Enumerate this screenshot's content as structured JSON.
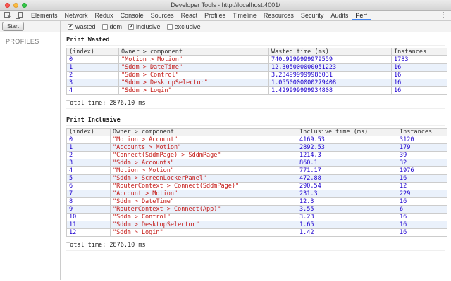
{
  "window": {
    "title": "Developer Tools - http://localhost:4001/"
  },
  "tabs": {
    "items": [
      {
        "label": "Elements",
        "active": false
      },
      {
        "label": "Network",
        "active": false
      },
      {
        "label": "Redux",
        "active": false
      },
      {
        "label": "Console",
        "active": false
      },
      {
        "label": "Sources",
        "active": false
      },
      {
        "label": "React",
        "active": false
      },
      {
        "label": "Profiles",
        "active": false
      },
      {
        "label": "Timeline",
        "active": false
      },
      {
        "label": "Resources",
        "active": false
      },
      {
        "label": "Security",
        "active": false
      },
      {
        "label": "Audits",
        "active": false
      },
      {
        "label": "Perf",
        "active": true
      }
    ],
    "icons": [
      "inspect-element-icon",
      "device-toolbar-icon",
      "more-options-icon"
    ]
  },
  "toolbar": {
    "start_label": "Start",
    "checkboxes": [
      {
        "label": "wasted",
        "checked": true
      },
      {
        "label": "dom",
        "checked": false
      },
      {
        "label": "inclusive",
        "checked": true
      },
      {
        "label": "exclusive",
        "checked": false
      }
    ]
  },
  "sidebar": {
    "heading": "PROFILES"
  },
  "main": {
    "sections": [
      {
        "title": "Print Wasted",
        "table": {
          "columns": [
            "(index)",
            "Owner > component",
            "Wasted time (ms)",
            "Instances"
          ],
          "rows": [
            [
              "0",
              "\"Motion > Motion\"",
              "740.9299999979559",
              "1783"
            ],
            [
              "1",
              "\"Sddm > DateTime\"",
              "12.305000000051223",
              "16"
            ],
            [
              "2",
              "\"Sddm > Control\"",
              "3.234999999986031",
              "16"
            ],
            [
              "3",
              "\"Sddm > DesktopSelector\"",
              "1.0550000000279408",
              "16"
            ],
            [
              "4",
              "\"Sddm > Login\"",
              "1.429999999934808",
              "16"
            ]
          ]
        },
        "total": "Total time: 2876.10 ms"
      },
      {
        "title": "Print Inclusive",
        "table": {
          "columns": [
            "(index)",
            "Owner > component",
            "Inclusive time (ms)",
            "Instances"
          ],
          "rows": [
            [
              "0",
              "\"Motion > Account\"",
              "4169.53",
              "3120"
            ],
            [
              "1",
              "\"Accounts > Motion\"",
              "2892.53",
              "179"
            ],
            [
              "2",
              "\"Connect(SddmPage) > SddmPage\"",
              "1214.3",
              "39"
            ],
            [
              "3",
              "\"Sddm > Accounts\"",
              "860.1",
              "32"
            ],
            [
              "4",
              "\"Motion > Motion\"",
              "771.17",
              "1976"
            ],
            [
              "5",
              "\"Sddm > ScreenLockerPanel\"",
              "472.88",
              "16"
            ],
            [
              "6",
              "\"RouterContext > Connect(SddmPage)\"",
              "290.54",
              "12"
            ],
            [
              "7",
              "\"Account > Motion\"",
              "231.3",
              "229"
            ],
            [
              "8",
              "\"Sddm > DateTime\"",
              "12.3",
              "16"
            ],
            [
              "9",
              "\"RouterContext > Connect(App)\"",
              "3.55",
              "6"
            ],
            [
              "10",
              "\"Sddm > Control\"",
              "3.23",
              "16"
            ],
            [
              "11",
              "\"Sddm > DesktopSelector\"",
              "1.65",
              "16"
            ],
            [
              "12",
              "\"Sddm > Login\"",
              "1.42",
              "16"
            ]
          ]
        },
        "total": "Total time: 2876.10 ms"
      }
    ]
  },
  "colors": {
    "accent": "#4285f4",
    "string_value": "#c41a16",
    "number_value": "#1c00cf",
    "row_stripe": "#eaf1fb",
    "chrome_bg": "#f3f3f3"
  }
}
